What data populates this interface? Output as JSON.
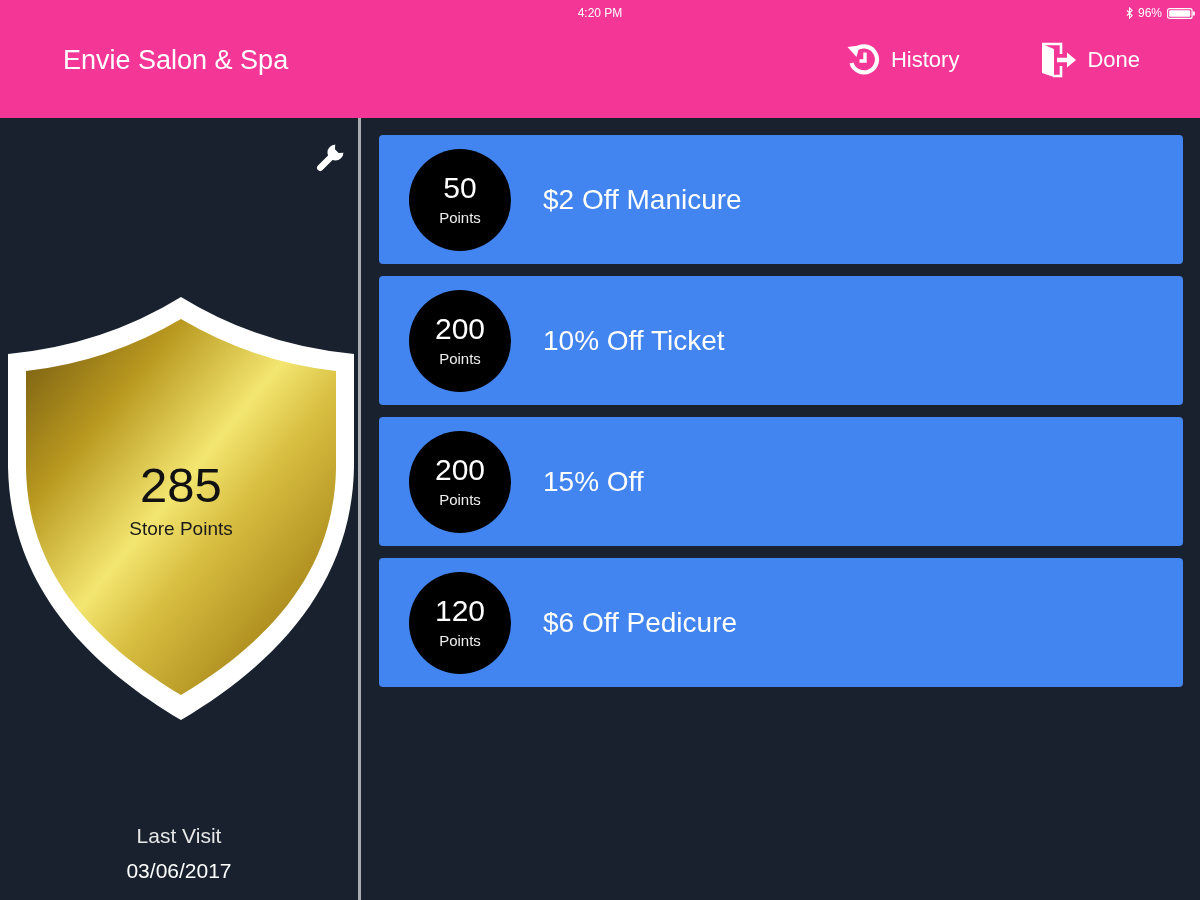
{
  "status_bar": {
    "time": "4:20 PM",
    "battery_text": "96%"
  },
  "header": {
    "title": "Envie Salon & Spa",
    "actions": [
      {
        "kind": "history",
        "label": "History"
      },
      {
        "kind": "done",
        "label": "Done"
      }
    ]
  },
  "sidebar": {
    "points": "285",
    "points_label": "Store Points",
    "last_visit_label": "Last Visit",
    "last_visit_date": "03/06/2017"
  },
  "rewards": [
    {
      "points": "50",
      "points_unit": "Points",
      "title": "$2 Off Manicure"
    },
    {
      "points": "200",
      "points_unit": "Points",
      "title": "10% Off Ticket"
    },
    {
      "points": "200",
      "points_unit": "Points",
      "title": "15% Off"
    },
    {
      "points": "120",
      "points_unit": "Points",
      "title": "$6 Off Pedicure"
    }
  ]
}
